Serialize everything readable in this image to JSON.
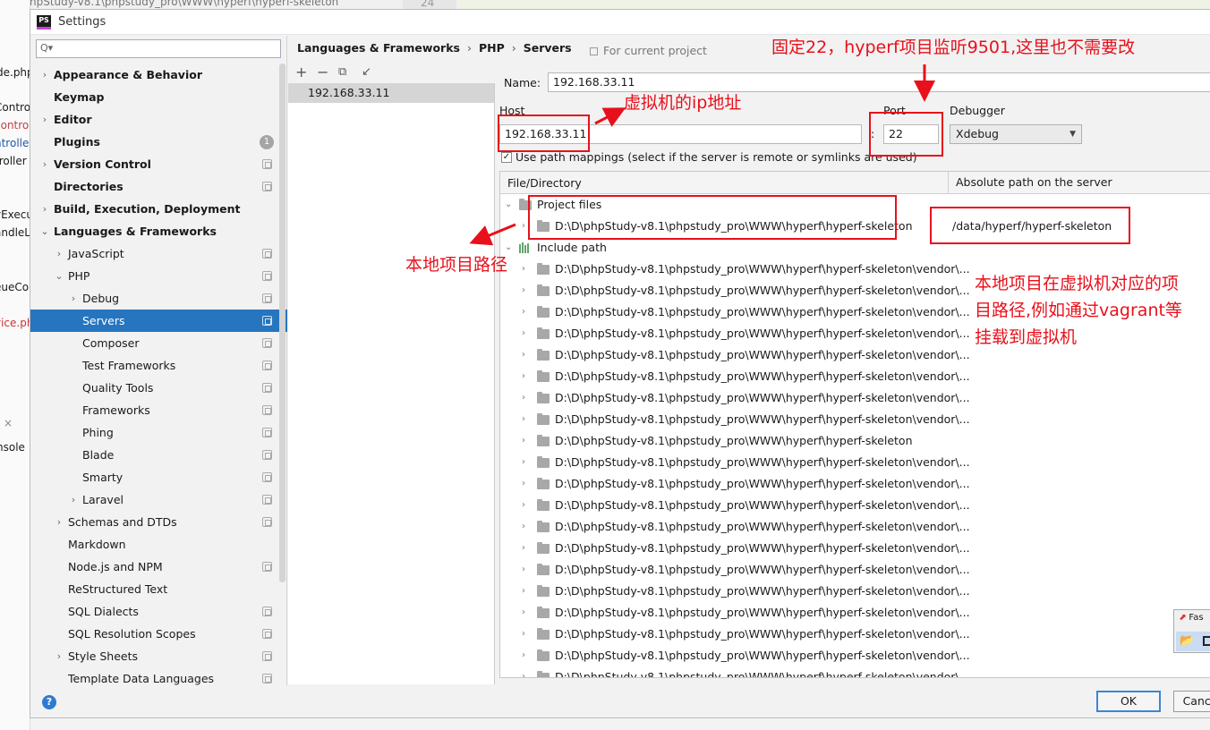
{
  "background": {
    "top_text": ":\\D\\phpStudy-v8.1\\phpstudy_pro\\WWW\\hyperf\\hyperf-skeleton",
    "line_number": "24",
    "left_fragments": [
      "de.php",
      "Contro",
      "control",
      "ntrolle",
      "troller",
      "yExecu",
      "andleL",
      "eueCo",
      "vice.ph",
      "×",
      "nsole"
    ]
  },
  "window": {
    "title": "Settings",
    "logo": "PS"
  },
  "sidebar": {
    "search_placeholder": "",
    "items": [
      {
        "label": "Appearance & Behavior"
      },
      {
        "label": "Keymap"
      },
      {
        "label": "Editor"
      },
      {
        "label": "Plugins",
        "badge": "1"
      },
      {
        "label": "Version Control"
      },
      {
        "label": "Directories"
      },
      {
        "label": "Build, Execution, Deployment"
      },
      {
        "label": "Languages & Frameworks"
      },
      {
        "label": "JavaScript"
      },
      {
        "label": "PHP"
      },
      {
        "label": "Debug"
      },
      {
        "label": "Servers"
      },
      {
        "label": "Composer"
      },
      {
        "label": "Test Frameworks"
      },
      {
        "label": "Quality Tools"
      },
      {
        "label": "Frameworks"
      },
      {
        "label": "Phing"
      },
      {
        "label": "Blade"
      },
      {
        "label": "Smarty"
      },
      {
        "label": "Laravel"
      },
      {
        "label": "Schemas and DTDs"
      },
      {
        "label": "Markdown"
      },
      {
        "label": "Node.js and NPM"
      },
      {
        "label": "ReStructured Text"
      },
      {
        "label": "SQL Dialects"
      },
      {
        "label": "SQL Resolution Scopes"
      },
      {
        "label": "Style Sheets"
      },
      {
        "label": "Template Data Languages"
      }
    ]
  },
  "breadcrumb": {
    "parts": [
      "Languages & Frameworks",
      "PHP",
      "Servers"
    ],
    "separator": "›"
  },
  "for_current_project": "For current project",
  "server_list": {
    "toolbar": [
      "+",
      "−",
      "⧉",
      "↙"
    ],
    "items": [
      "192.168.33.11"
    ]
  },
  "form": {
    "name_label": "Name:",
    "name_value": "192.168.33.11",
    "host_label": "Host",
    "host_value": "192.168.33.11",
    "port_label": "Port",
    "port_colon": ":",
    "port_value": "22",
    "debugger_label": "Debugger",
    "debugger_value": "Xdebug",
    "use_path_mappings": "Use path mappings (select if the server is remote or symlinks are used)",
    "use_path_mappings_checked": true
  },
  "mapping_table": {
    "col_file": "File/Directory",
    "col_abs": "Absolute path on the server",
    "project_files_label": "Project files",
    "project_path": "D:\\D\\phpStudy-v8.1\\phpstudy_pro\\WWW\\hyperf\\hyperf-skeleton",
    "project_server_path": "/data/hyperf/hyperf-skeleton",
    "include_path_label": "Include path",
    "include_rows": [
      "D:\\D\\phpStudy-v8.1\\phpstudy_pro\\WWW\\hyperf\\hyperf-skeleton\\vendor\\...",
      "D:\\D\\phpStudy-v8.1\\phpstudy_pro\\WWW\\hyperf\\hyperf-skeleton\\vendor\\...",
      "D:\\D\\phpStudy-v8.1\\phpstudy_pro\\WWW\\hyperf\\hyperf-skeleton\\vendor\\...",
      "D:\\D\\phpStudy-v8.1\\phpstudy_pro\\WWW\\hyperf\\hyperf-skeleton\\vendor\\...",
      "D:\\D\\phpStudy-v8.1\\phpstudy_pro\\WWW\\hyperf\\hyperf-skeleton\\vendor\\...",
      "D:\\D\\phpStudy-v8.1\\phpstudy_pro\\WWW\\hyperf\\hyperf-skeleton\\vendor\\...",
      "D:\\D\\phpStudy-v8.1\\phpstudy_pro\\WWW\\hyperf\\hyperf-skeleton\\vendor\\...",
      "D:\\D\\phpStudy-v8.1\\phpstudy_pro\\WWW\\hyperf\\hyperf-skeleton\\vendor\\...",
      "D:\\D\\phpStudy-v8.1\\phpstudy_pro\\WWW\\hyperf\\hyperf-skeleton",
      "D:\\D\\phpStudy-v8.1\\phpstudy_pro\\WWW\\hyperf\\hyperf-skeleton\\vendor\\...",
      "D:\\D\\phpStudy-v8.1\\phpstudy_pro\\WWW\\hyperf\\hyperf-skeleton\\vendor\\...",
      "D:\\D\\phpStudy-v8.1\\phpstudy_pro\\WWW\\hyperf\\hyperf-skeleton\\vendor\\...",
      "D:\\D\\phpStudy-v8.1\\phpstudy_pro\\WWW\\hyperf\\hyperf-skeleton\\vendor\\...",
      "D:\\D\\phpStudy-v8.1\\phpstudy_pro\\WWW\\hyperf\\hyperf-skeleton\\vendor\\...",
      "D:\\D\\phpStudy-v8.1\\phpstudy_pro\\WWW\\hyperf\\hyperf-skeleton\\vendor\\...",
      "D:\\D\\phpStudy-v8.1\\phpstudy_pro\\WWW\\hyperf\\hyperf-skeleton\\vendor\\...",
      "D:\\D\\phpStudy-v8.1\\phpstudy_pro\\WWW\\hyperf\\hyperf-skeleton\\vendor\\...",
      "D:\\D\\phpStudy-v8.1\\phpstudy_pro\\WWW\\hyperf\\hyperf-skeleton\\vendor\\...",
      "D:\\D\\phpStudy-v8.1\\phpstudy_pro\\WWW\\hyperf\\hyperf-skeleton\\vendor\\...",
      "D:\\D\\phpStudy-v8.1\\phpstudy_pro\\WWW\\hyperf\\hyperf-skeleton\\vendor\\..."
    ]
  },
  "buttons": {
    "help": "?",
    "ok": "OK",
    "cancel": "Cance"
  },
  "mini_window": {
    "label": "Fas"
  },
  "annotations": {
    "port_note": "固定22，hyperf项目监听9501,这里也不需要改",
    "host_note": "虚拟机的ip地址",
    "local_note": "本地项目路径",
    "server_note": "本地项目在虚拟机对应的项目路径,例如通过vagrant等挂载到虚拟机",
    "color": "#e8101b"
  }
}
